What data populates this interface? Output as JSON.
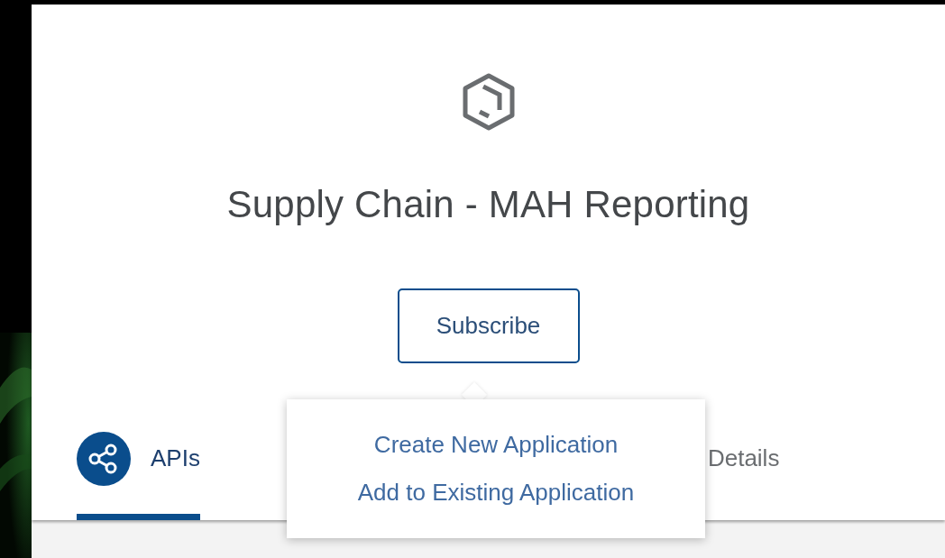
{
  "app": {
    "title": "Supply Chain - MAH Reporting"
  },
  "subscribe_button": {
    "label": "Subscribe"
  },
  "tabs": [
    {
      "label": "APIs",
      "selected": true,
      "kind": "icon"
    },
    {
      "label": "Details",
      "selected": false,
      "kind": "text"
    }
  ],
  "menu": {
    "items": [
      {
        "label": "Create New Application"
      },
      {
        "label": "Add to Existing Application"
      }
    ]
  }
}
